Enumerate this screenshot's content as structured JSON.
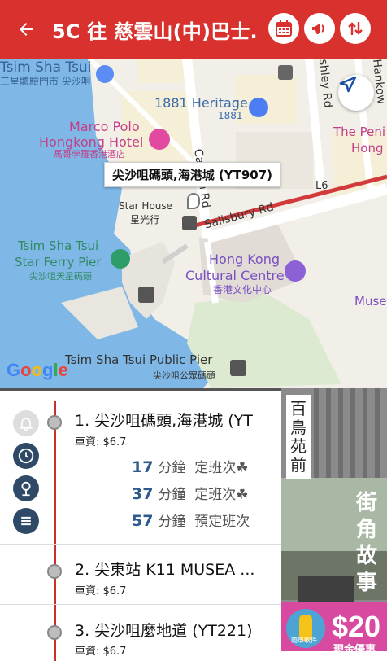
{
  "header": {
    "title": "5C 往 慈雲山(中)巴士...",
    "back_icon": "back-arrow-icon",
    "buttons": [
      "calendar-icon",
      "megaphone-icon",
      "swap-direction-icon"
    ],
    "color": "#d9312e"
  },
  "map": {
    "callout": "尖沙咀碼頭,海港城 (YT907)",
    "labels": {
      "tst_en": "Tsim Sha Tsui",
      "tst_zh": "尖沙咀",
      "space_museum": "三星體驗門市 尖沙咀",
      "heritage_en": "1881 Heritage",
      "heritage_zh": "1881",
      "marco_en1": "Marco Polo",
      "marco_en2": "Hongkong Hotel",
      "marco_zh": "馬哥孛羅香港酒店",
      "peninsula_en1": "The Peni",
      "peninsula_en2": "Hong",
      "star_house_en": "Star House",
      "star_house_zh": "星光行",
      "ferry_en1": "Tsim Sha Tsui",
      "ferry_en2": "Star Ferry Pier",
      "ferry_zh": "尖沙咀天星碼頭",
      "salisbury": "Salisbury Rd",
      "canton": "Canton Rd",
      "ashley": "shley Rd",
      "hankow": "Hankow",
      "culture_en1": "Hong Kong",
      "culture_en2": "Cultural Centre",
      "culture_zh": "香港文化中心",
      "muse": "Muse",
      "public_pier_en": "Tsim Sha Tsui Public Pier",
      "public_pier_zh": "尖沙咀公眾碼頭",
      "route_l6": "L6",
      "google": "Google"
    }
  },
  "sidebar_icons": [
    "bell-icon",
    "clock-icon",
    "map-pin-icon",
    "menu-icon"
  ],
  "stops": [
    {
      "name": "1. 尖沙咀碼頭,海港城 (YT",
      "fare": "車資: $6.7",
      "etas": [
        {
          "minutes": "17",
          "unit": "分鐘",
          "note": "定班次☘"
        },
        {
          "minutes": "37",
          "unit": "分鐘",
          "note": "定班次☘"
        },
        {
          "minutes": "57",
          "unit": "分鐘",
          "note": "預定班次"
        }
      ]
    },
    {
      "name": "2. 尖東站 K11 MUSEA ...",
      "fare": "車資: $6.7"
    },
    {
      "name": "3. 尖沙咀麼地道 (YT221)",
      "fare": "車資: $6.7"
    }
  ],
  "ad": {
    "vertical1": "百鳥苑前",
    "vertical2": "街角故事",
    "price": "$20",
    "promo": "現金優惠",
    "badge": "簡單軟件"
  }
}
